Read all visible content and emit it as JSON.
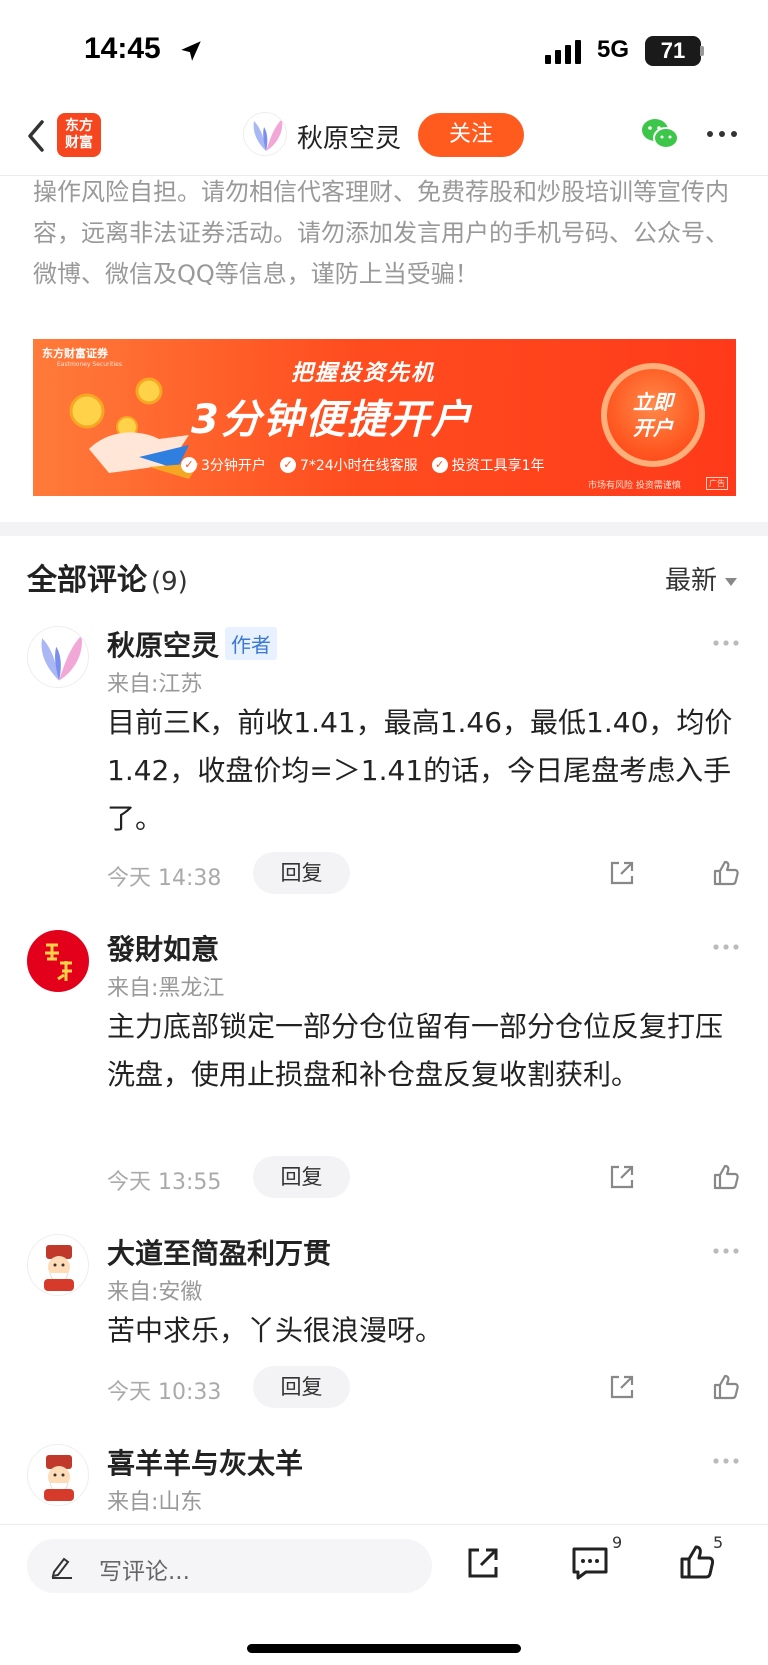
{
  "status_bar": {
    "time": "14:45",
    "network": "5G",
    "battery": "71"
  },
  "nav": {
    "logo_text_line1": "东方",
    "logo_text_line2": "财富",
    "author_name": "秋原空灵",
    "follow_label": "关注"
  },
  "disclaimer": "操作风险自担。请勿相信代客理财、免费荐股和炒股培训等宣传内容，远离非法证券活动。请勿添加发言用户的手机号码、公众号、微博、微信及QQ等信息，谨防上当受骗！",
  "banner": {
    "brand": "东方财富证券",
    "brand_en": "Eastmoney Securities",
    "subtitle": "把握投资先机",
    "headline": "3分钟便捷开户",
    "features": [
      "3分钟开户",
      "7*24小时在线客服",
      "投资工具享1年"
    ],
    "cta_line1": "立即",
    "cta_line2": "开户",
    "risk_note": "市场有风险 投资需谨慎",
    "ad_tag": "广告"
  },
  "comments_section": {
    "title": "全部评论",
    "count": "(9)",
    "sort_label": "最新"
  },
  "comments": [
    {
      "name": "秋原空灵",
      "tag": "作者",
      "location": "来自:江苏",
      "body": "目前三K，前收1.41，最高1.46，最低1.40，均价1.42，收盘价均=＞1.41的话，今日尾盘考虑入手了。",
      "time": "今天 14:38",
      "reply_label": "回复"
    },
    {
      "name": "發財如意",
      "location": "来自:黑龙江",
      "body": "主力底部锁定一部分仓位留有一部分仓位反复打压洗盘，使用止损盘和补仓盘反复收割获利。",
      "time": "今天 13:55",
      "reply_label": "回复"
    },
    {
      "name": "大道至简盈利万贯",
      "location": "来自:安徽",
      "body": "苦中求乐，丫头很浪漫呀。",
      "time": "今天 10:33",
      "reply_label": "回复"
    },
    {
      "name": "喜羊羊与灰太羊",
      "location": "来自:山东"
    }
  ],
  "bottom_bar": {
    "placeholder": "写评论...",
    "comment_count": "9",
    "like_count": "5"
  },
  "colors": {
    "accent": "#ff5b1f",
    "tag_blue": "#3a78d4"
  }
}
